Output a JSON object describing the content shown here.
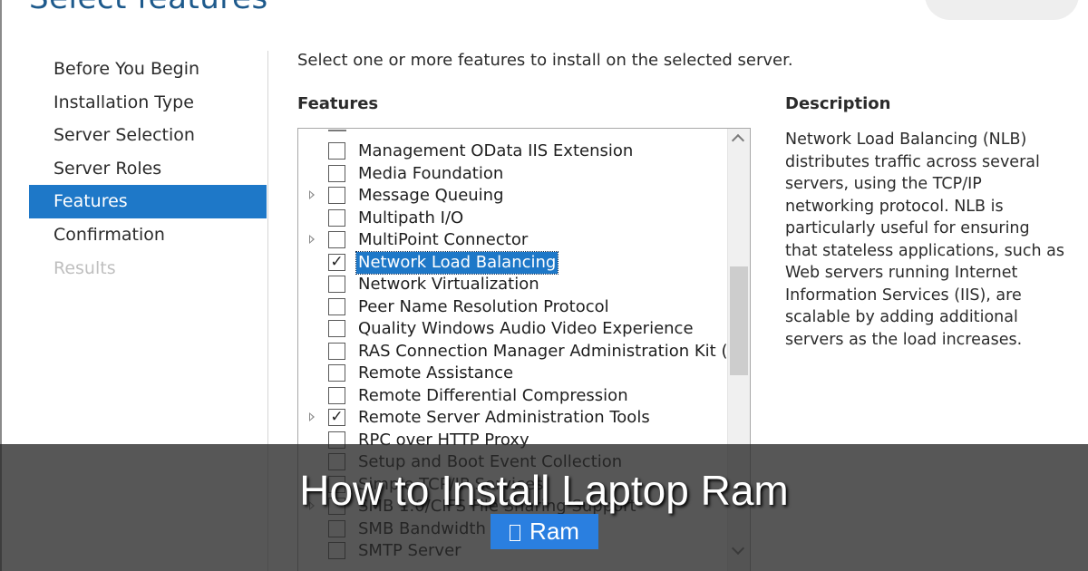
{
  "page_title": "Select features",
  "nav": {
    "items": [
      {
        "label": "Before You Begin",
        "state": "normal"
      },
      {
        "label": "Installation Type",
        "state": "normal"
      },
      {
        "label": "Server Selection",
        "state": "normal"
      },
      {
        "label": "Server Roles",
        "state": "normal"
      },
      {
        "label": "Features",
        "state": "active"
      },
      {
        "label": "Confirmation",
        "state": "normal"
      },
      {
        "label": "Results",
        "state": "disabled"
      }
    ]
  },
  "instruction": "Select one or more features to install on the selected server.",
  "features_heading": "Features",
  "features": [
    {
      "label": "Management OData IIS Extension",
      "checked": false,
      "expandable": false,
      "selected": false
    },
    {
      "label": "Media Foundation",
      "checked": false,
      "expandable": false,
      "selected": false
    },
    {
      "label": "Message Queuing",
      "checked": false,
      "expandable": true,
      "selected": false
    },
    {
      "label": "Multipath I/O",
      "checked": false,
      "expandable": false,
      "selected": false
    },
    {
      "label": "MultiPoint Connector",
      "checked": false,
      "expandable": true,
      "selected": false
    },
    {
      "label": "Network Load Balancing",
      "checked": true,
      "expandable": false,
      "selected": true
    },
    {
      "label": "Network Virtualization",
      "checked": false,
      "expandable": false,
      "selected": false
    },
    {
      "label": "Peer Name Resolution Protocol",
      "checked": false,
      "expandable": false,
      "selected": false
    },
    {
      "label": "Quality Windows Audio Video Experience",
      "checked": false,
      "expandable": false,
      "selected": false
    },
    {
      "label": "RAS Connection Manager Administration Kit (CMA",
      "checked": false,
      "expandable": false,
      "selected": false
    },
    {
      "label": "Remote Assistance",
      "checked": false,
      "expandable": false,
      "selected": false
    },
    {
      "label": "Remote Differential Compression",
      "checked": false,
      "expandable": false,
      "selected": false
    },
    {
      "label": "Remote Server Administration Tools",
      "checked": true,
      "expandable": true,
      "selected": false
    },
    {
      "label": "RPC over HTTP Proxy",
      "checked": false,
      "expandable": false,
      "selected": false
    },
    {
      "label": "Setup and Boot Event Collection",
      "checked": false,
      "expandable": false,
      "selected": false
    },
    {
      "label": "Simple TCP/IP Services",
      "checked": false,
      "expandable": false,
      "selected": false
    },
    {
      "label": "SMB 1.0/CIFS File Sharing Support",
      "checked": false,
      "expandable": true,
      "selected": false
    },
    {
      "label": "SMB Bandwidth Limit",
      "checked": false,
      "expandable": false,
      "selected": false
    },
    {
      "label": "SMTP Server",
      "checked": false,
      "expandable": false,
      "selected": false
    }
  ],
  "check_glyph": "✓",
  "description_heading": "Description",
  "description": "Network Load Balancing (NLB) distributes traffic across several servers, using the TCP/IP networking protocol. NLB is particularly useful for ensuring that stateless applications, such as Web servers running Internet Information Services (IIS), are scalable by adding additional servers as the load increases.",
  "overlay": {
    "title": "How to Install Laptop Ram",
    "tag": "Ram"
  },
  "colors": {
    "accent": "#1e78c8",
    "tag_bg": "#2a7fe0",
    "title_blue": "#1e5a8c"
  }
}
